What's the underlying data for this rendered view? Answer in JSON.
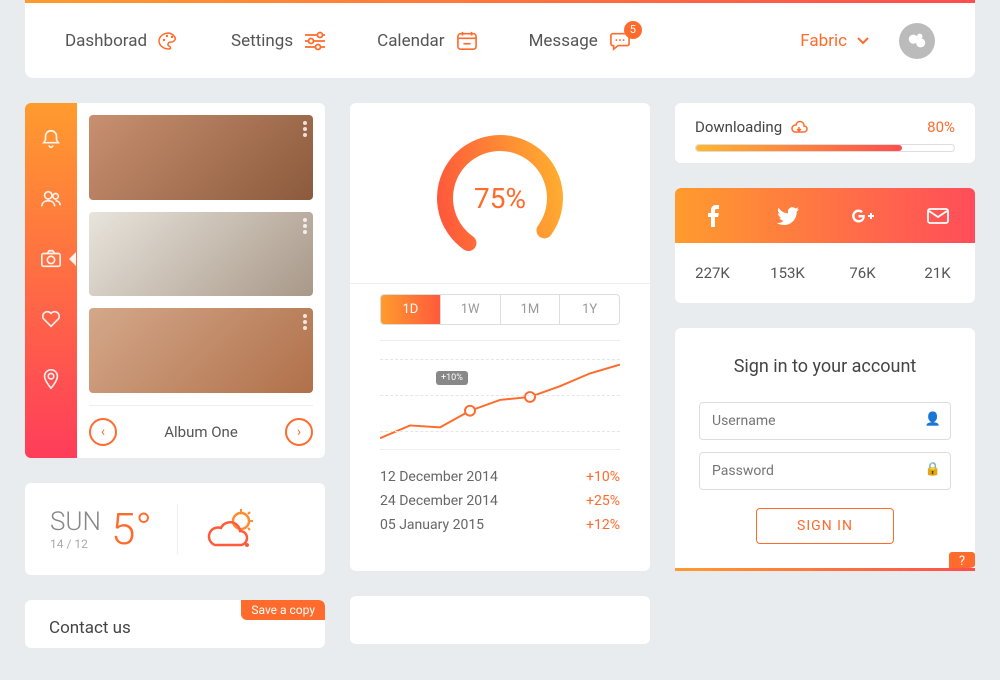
{
  "nav": {
    "dashboard": "Dashborad",
    "settings": "Settings",
    "calendar": "Calendar",
    "message": "Message",
    "message_badge": "5",
    "brand": "Fabric"
  },
  "album": {
    "title": "Album One"
  },
  "weather": {
    "day": "SUN",
    "date": "14 / 12",
    "temp": "5°"
  },
  "progress": {
    "percent": "75%",
    "tabs": [
      "1D",
      "1W",
      "1M",
      "1Y"
    ],
    "annotation": "+10%",
    "history": [
      {
        "date": "12 December 2014",
        "value": "+10%"
      },
      {
        "date": "24 December 2014",
        "value": "+25%"
      },
      {
        "date": "05 January 2015",
        "value": "+12%"
      }
    ]
  },
  "download": {
    "label": "Downloading",
    "percent": "80%"
  },
  "social": {
    "counts": [
      "227K",
      "153K",
      "76K",
      "21K"
    ]
  },
  "signin": {
    "title": "Sign in to your account",
    "username_ph": "Username",
    "password_ph": "Password",
    "button": "SIGN IN",
    "help": "?"
  },
  "contact": {
    "title": "Contact us",
    "save": "Save a copy"
  },
  "chart_data": {
    "type": "line",
    "x": [
      0,
      1,
      2,
      3,
      4,
      5,
      6,
      7,
      8
    ],
    "values": [
      10,
      22,
      20,
      35,
      45,
      48,
      58,
      70,
      78
    ],
    "ylim": [
      0,
      100
    ],
    "annotation": {
      "x": 3.5,
      "label": "+10%"
    },
    "markers": [
      3,
      5
    ]
  }
}
